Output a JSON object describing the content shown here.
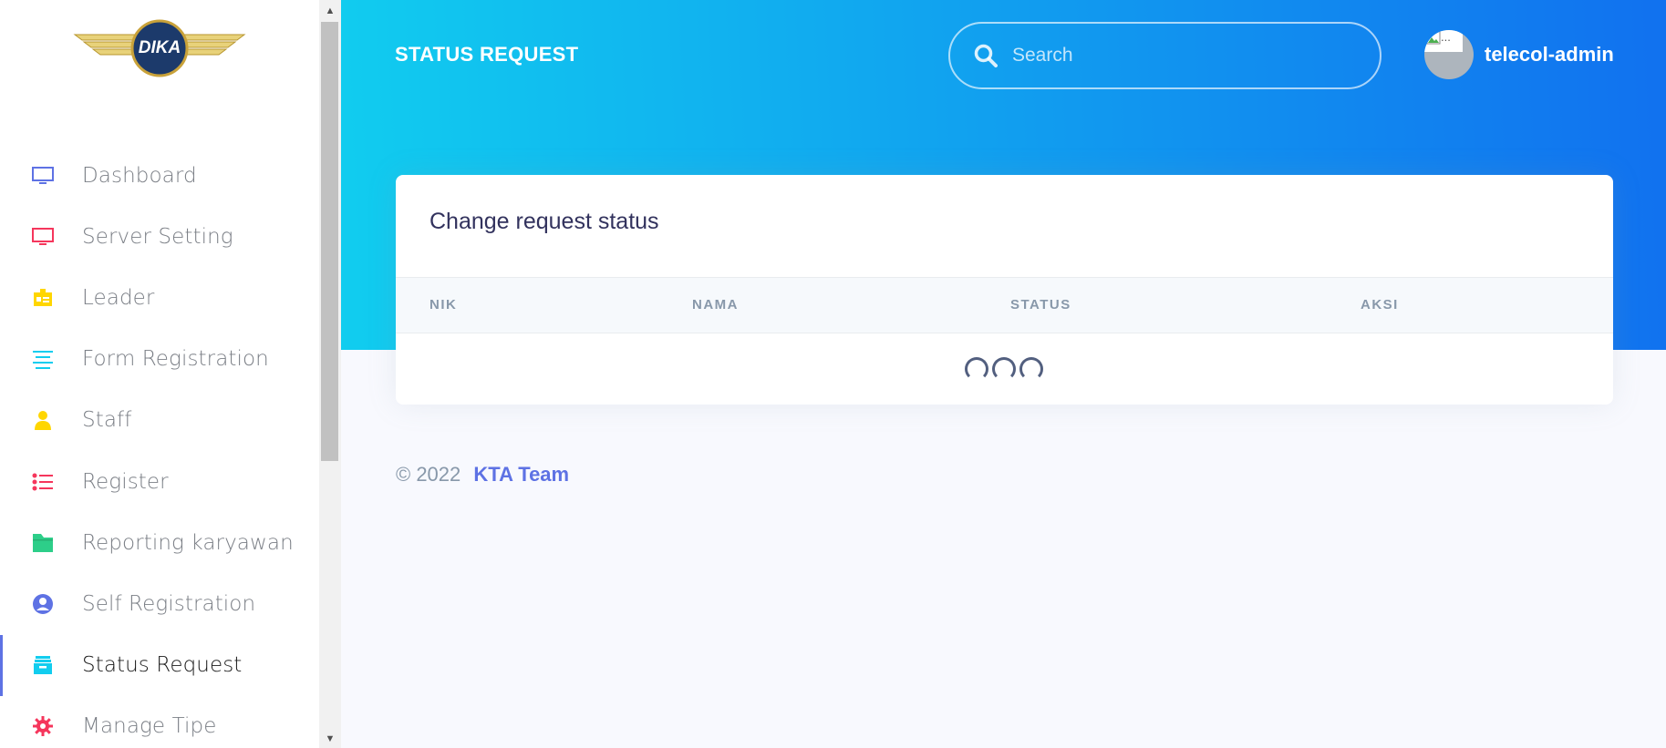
{
  "logo": {
    "text": "DIKA"
  },
  "sidebar": {
    "items": [
      {
        "label": "Dashboard",
        "icon": "monitor-icon",
        "color": "#5e72e4",
        "active": false
      },
      {
        "label": "Server Setting",
        "icon": "monitor-icon",
        "color": "#f5365c",
        "active": false
      },
      {
        "label": "Leader",
        "icon": "id-badge-icon",
        "color": "#ffd600",
        "active": false
      },
      {
        "label": "Form Registration",
        "icon": "align-lines-icon",
        "color": "#11cdef",
        "active": false
      },
      {
        "label": "Staff",
        "icon": "user-icon",
        "color": "#ffd600",
        "active": false
      },
      {
        "label": "Register",
        "icon": "bullet-list-icon",
        "color": "#f5365c",
        "active": false
      },
      {
        "label": "Reporting karyawan",
        "icon": "folder-icon",
        "color": "#2dce89",
        "active": false
      },
      {
        "label": "Self Registration",
        "icon": "user-circle-icon",
        "color": "#5e72e4",
        "active": false
      },
      {
        "label": "Status Request",
        "icon": "archive-icon",
        "color": "#11cdef",
        "active": true
      },
      {
        "label": "Manage Tipe",
        "icon": "gear-icon",
        "color": "#f5365c",
        "active": false
      }
    ]
  },
  "header": {
    "title": "STATUS REQUEST",
    "search_placeholder": "Search",
    "username": "telecol-admin",
    "avatar_alt": "..."
  },
  "card": {
    "title": "Change request status",
    "columns": [
      "NIK",
      "NAMA",
      "STATUS",
      "AKSI"
    ]
  },
  "footer": {
    "copyright": "© 2022",
    "link": "KTA Team"
  },
  "colors": {
    "gradient_start": "#11cdef",
    "gradient_end": "#1171ef",
    "primary": "#5e72e4"
  }
}
